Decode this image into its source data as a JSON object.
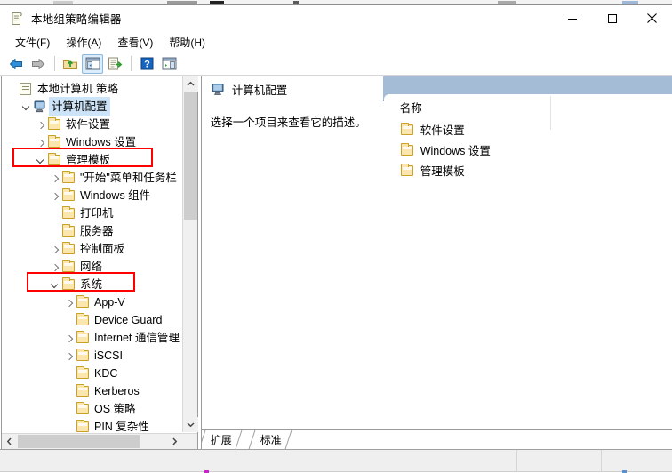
{
  "window": {
    "title": "本地组策略编辑器",
    "title_icon": "policy-document-icon",
    "buttons": {
      "minimize": "minimize-icon",
      "maximize": "maximize-icon",
      "close": "close-icon"
    }
  },
  "menubar": {
    "items": [
      {
        "label": "文件(F)",
        "name": "menu-file"
      },
      {
        "label": "操作(A)",
        "name": "menu-action"
      },
      {
        "label": "查看(V)",
        "name": "menu-view"
      },
      {
        "label": "帮助(H)",
        "name": "menu-help"
      }
    ]
  },
  "toolbar": {
    "items": [
      {
        "name": "back-arrow-icon",
        "label": "后退"
      },
      {
        "name": "forward-arrow-icon",
        "label": "前进"
      },
      {
        "name": "separator-1",
        "label": ""
      },
      {
        "name": "up-one-level-icon",
        "label": "上移一级"
      },
      {
        "name": "show-hide-console-tree-icon",
        "label": "显示/隐藏控制台树"
      },
      {
        "name": "export-list-icon",
        "label": "导出列表"
      },
      {
        "name": "separator-2",
        "label": ""
      },
      {
        "name": "help-icon",
        "label": "帮助"
      },
      {
        "name": "show-hide-action-pane-icon",
        "label": "显示/隐藏操作窗格"
      }
    ]
  },
  "tree": {
    "nodes": [
      {
        "label": "本地计算机 策略",
        "icon": "policy-document-icon",
        "indent": 0,
        "twist": "none",
        "selected": false
      },
      {
        "label": "计算机配置",
        "icon": "computer-icon",
        "indent": 1,
        "twist": "down",
        "selected": true
      },
      {
        "label": "软件设置",
        "icon": "folder-icon",
        "indent": 2,
        "twist": "right",
        "selected": false
      },
      {
        "label": "Windows 设置",
        "icon": "folder-icon",
        "indent": 2,
        "twist": "right",
        "selected": false
      },
      {
        "label": "管理模板",
        "icon": "folder-icon",
        "indent": 2,
        "twist": "down",
        "selected": false
      },
      {
        "label": "\"开始\"菜单和任务栏",
        "icon": "folder-icon",
        "indent": 3,
        "twist": "right",
        "selected": false
      },
      {
        "label": "Windows 组件",
        "icon": "folder-icon",
        "indent": 3,
        "twist": "right",
        "selected": false
      },
      {
        "label": "打印机",
        "icon": "folder-icon",
        "indent": 3,
        "twist": "none",
        "selected": false
      },
      {
        "label": "服务器",
        "icon": "folder-icon",
        "indent": 3,
        "twist": "none",
        "selected": false
      },
      {
        "label": "控制面板",
        "icon": "folder-icon",
        "indent": 3,
        "twist": "right",
        "selected": false
      },
      {
        "label": "网络",
        "icon": "folder-icon",
        "indent": 3,
        "twist": "right",
        "selected": false
      },
      {
        "label": "系统",
        "icon": "folder-icon",
        "indent": 3,
        "twist": "down",
        "selected": false
      },
      {
        "label": "App-V",
        "icon": "folder-icon",
        "indent": 4,
        "twist": "right",
        "selected": false
      },
      {
        "label": "Device Guard",
        "icon": "folder-icon",
        "indent": 4,
        "twist": "none",
        "selected": false
      },
      {
        "label": "Internet 通信管理",
        "icon": "folder-icon",
        "indent": 4,
        "twist": "right",
        "selected": false
      },
      {
        "label": "iSCSI",
        "icon": "folder-icon",
        "indent": 4,
        "twist": "right",
        "selected": false
      },
      {
        "label": "KDC",
        "icon": "folder-icon",
        "indent": 4,
        "twist": "none",
        "selected": false
      },
      {
        "label": "Kerberos",
        "icon": "folder-icon",
        "indent": 4,
        "twist": "none",
        "selected": false
      },
      {
        "label": "OS 策略",
        "icon": "folder-icon",
        "indent": 4,
        "twist": "none",
        "selected": false
      },
      {
        "label": "PIN 复杂性",
        "icon": "folder-icon",
        "indent": 4,
        "twist": "none",
        "selected": false
      }
    ]
  },
  "right_pane": {
    "header_title": "计算机配置",
    "header_icon": "computer-icon",
    "description": "选择一个项目来查看它的描述。",
    "list": {
      "column_header": "名称",
      "rows": [
        {
          "label": "软件设置",
          "icon": "folder-icon"
        },
        {
          "label": "Windows 设置",
          "icon": "folder-icon"
        },
        {
          "label": "管理模板",
          "icon": "folder-icon"
        }
      ]
    },
    "view_tabs": [
      {
        "label": "扩展",
        "active": false
      },
      {
        "label": "标准",
        "active": true
      }
    ]
  },
  "status_bar": {
    "pane_1": "",
    "pane_2": "",
    "pane_3": ""
  },
  "annotations": {
    "highlight_color": "#ff0000",
    "boxes": [
      {
        "target": "管理模板"
      },
      {
        "target": "系统"
      }
    ]
  },
  "colors": {
    "selection": "#cde3f7",
    "header_band": "#a5bcd7",
    "toolbar_active": "#dcecfb",
    "folder": "#fbe6b0",
    "annotation": "#ff0000"
  }
}
